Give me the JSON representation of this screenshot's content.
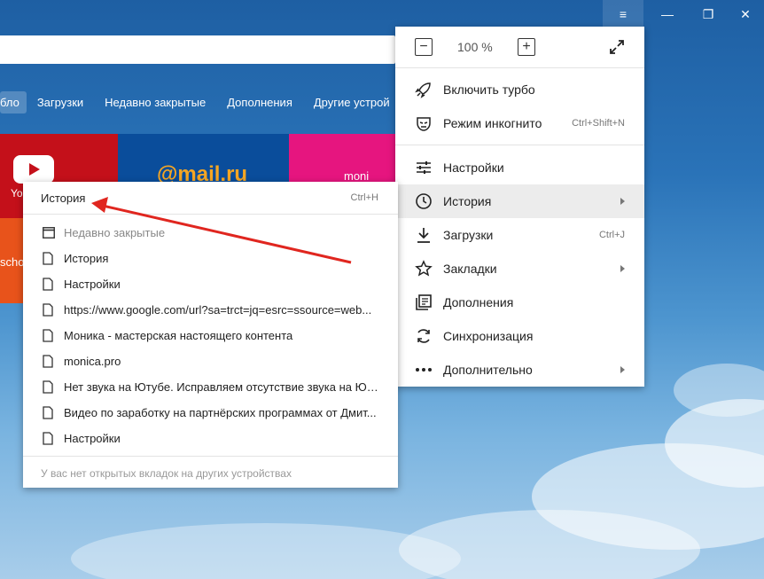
{
  "window": {
    "menu_icon": "≡",
    "min_icon": "—",
    "max_icon": "❐",
    "close_icon": "✕"
  },
  "navbar": {
    "items": [
      {
        "label": "бло",
        "active": true
      },
      {
        "label": "Загрузки"
      },
      {
        "label": "Недавно закрытые"
      },
      {
        "label": "Дополнения"
      },
      {
        "label": "Другие устрой"
      }
    ]
  },
  "tiles": {
    "youtube": "Yo",
    "mail": "@mail.ru",
    "monica": "moni",
    "orange": "scho"
  },
  "main_menu": {
    "zoom_value": "100 %",
    "items": [
      {
        "label": "Включить турбо",
        "icon": "rocket-icon"
      },
      {
        "label": "Режим инкогнито",
        "shortcut": "Ctrl+Shift+N",
        "icon": "incognito-icon"
      },
      {
        "label": "Настройки",
        "icon": "settings-sliders-icon"
      },
      {
        "label": "История",
        "icon": "clock-icon",
        "submenu": true,
        "highlighted": true
      },
      {
        "label": "Загрузки",
        "shortcut": "Ctrl+J",
        "icon": "download-icon"
      },
      {
        "label": "Закладки",
        "icon": "star-icon",
        "submenu": true
      },
      {
        "label": "Дополнения",
        "icon": "extensions-icon"
      },
      {
        "label": "Синхронизация",
        "icon": "sync-icon"
      },
      {
        "label": "Дополнительно",
        "icon": "more-dots-icon",
        "submenu": true
      }
    ]
  },
  "history_menu": {
    "title": "История",
    "shortcut": "Ctrl+H",
    "items": [
      {
        "label": "Недавно закрытые",
        "icon": "window-icon",
        "gray": true
      },
      {
        "label": "История",
        "icon": "page-icon"
      },
      {
        "label": "Настройки",
        "icon": "page-icon"
      },
      {
        "label": "https://www.google.com/url?sa=trct=jq=esrc=ssource=web...",
        "icon": "page-icon"
      },
      {
        "label": "Моника - мастерская настоящего контента",
        "icon": "page-icon"
      },
      {
        "label": "monica.pro",
        "icon": "page-icon"
      },
      {
        "label": "Нет звука на Ютубе. Исправляем отсутствие звука на Юту...",
        "icon": "page-icon"
      },
      {
        "label": "Видео по заработку на партнёрских программах от Дмит...",
        "icon": "page-icon"
      },
      {
        "label": "Настройки",
        "icon": "page-icon"
      }
    ],
    "footer": "У вас нет открытых вкладок на других устройствах"
  },
  "colors": {
    "annotation_arrow": "#e0261f",
    "youtube_red": "#c4101a",
    "mail_blue": "#0a4d9b",
    "monica_pink": "#e6157f"
  }
}
